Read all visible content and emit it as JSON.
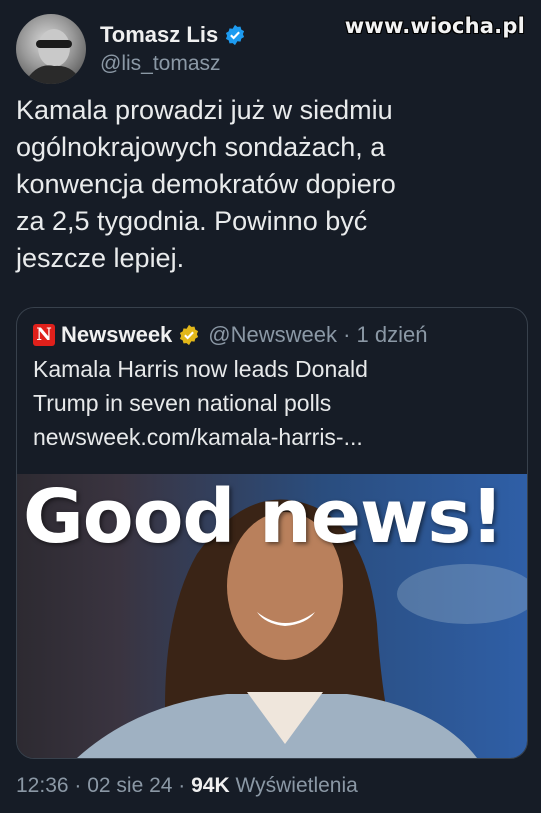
{
  "watermark": "www.wiocha.pl",
  "author": {
    "display_name": "Tomasz Lis",
    "handle": "@lis_tomasz",
    "verified_icon": "verified-badge-icon"
  },
  "tweet": {
    "text": "Kamala prowadzi już w siedmiu\nogólnokrajowych sondażach, a\nkonwencja demokratów  dopiero\nza 2,5 tygodnia. Powinno być\njeszcze lepiej."
  },
  "quoted": {
    "logo_letter": "N",
    "name": "Newsweek",
    "handle_time": "@Newsweek · 1 dzień",
    "text": "Kamala Harris now leads Donald\nTrump in seven national polls\nnewsweek.com/kamala-harris-...",
    "image_overlay": "Good news!"
  },
  "footer": {
    "time": "12:36 · 02 sie 24 · ",
    "views_count": "94K",
    "views_label": " Wyświetlenia"
  },
  "colors": {
    "background": "#161c26",
    "verified_blue": "#1d9bf0",
    "verified_gold": "#e2b719",
    "newsweek_red": "#e0201b"
  }
}
